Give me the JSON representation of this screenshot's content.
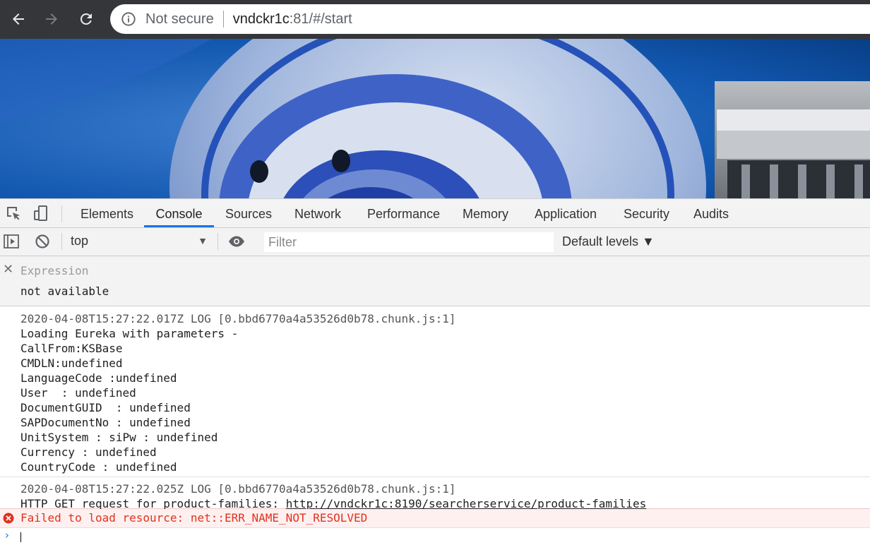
{
  "browser": {
    "security_label": "Not secure",
    "url_host": "vndckr1c",
    "url_rest": ":81/#/start"
  },
  "devtools": {
    "tabs": [
      "Elements",
      "Console",
      "Sources",
      "Network",
      "Performance",
      "Memory",
      "Application",
      "Security",
      "Audits"
    ],
    "active_tab": "Console",
    "toolbar": {
      "context": "top",
      "filter_placeholder": "Filter",
      "levels_label": "Default levels ▼"
    },
    "expression": {
      "label": "Expression",
      "value": "not available"
    },
    "messages": [
      {
        "meta": "2020-04-08T15:27:22.017Z LOG [0.bbd6770a4a53526d0b78.chunk.js:1]",
        "lines": [
          "Loading Eureka with parameters -",
          "CallFrom:KSBase",
          "CMDLN:undefined",
          "LanguageCode :undefined",
          "User  : undefined",
          "DocumentGUID  : undefined",
          "SAPDocumentNo : undefined",
          "UnitSystem : siPw : undefined",
          "Currency : undefined",
          "CountryCode : undefined"
        ]
      },
      {
        "meta": "2020-04-08T15:27:22.025Z LOG [0.bbd6770a4a53526d0b78.chunk.js:1]",
        "text": "HTTP GET request for product-families: ",
        "link": "http://vndckr1c:8190/searcherservice/product-families"
      }
    ],
    "error": "Failed to load resource: net::ERR_NAME_NOT_RESOLVED"
  },
  "colors": {
    "chrome_bg": "#35363a",
    "accent_blue": "#1a73e8",
    "error_red": "#e0321e",
    "banner_blue": "#0f4fa3"
  }
}
